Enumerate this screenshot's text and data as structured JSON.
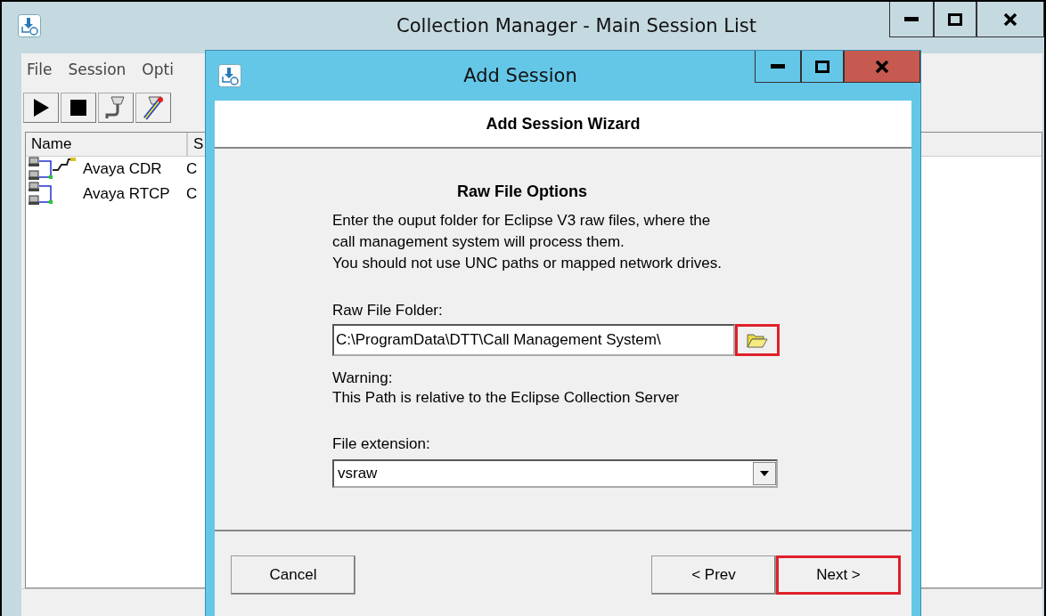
{
  "main_window": {
    "title": "Collection Manager - Main Session List",
    "menu": [
      "File",
      "Session",
      "Opti"
    ],
    "toolbar": [
      {
        "kind": "play"
      },
      {
        "kind": "stop"
      },
      {
        "kind": "connector"
      },
      {
        "kind": "connector-edit"
      }
    ],
    "list": {
      "columns": [
        "Name",
        "S"
      ],
      "rows": [
        {
          "name": "Avaya CDR",
          "column_2": "C",
          "kind": "cdr"
        },
        {
          "name": "Avaya RTCP",
          "column_2": "C",
          "kind": "plain"
        }
      ]
    }
  },
  "dialog": {
    "title": "Add Session",
    "header": "Add Session Wizard",
    "section_title": "Raw File Options",
    "description": [
      "Enter the ouput folder for Eclipse V3 raw files, where the",
      "call management system will process them.",
      "You should not use UNC paths or mapped  network drives."
    ],
    "folder_label": "Raw File Folder:",
    "folder_value": "C:\\ProgramData\\DTT\\Call Management System\\",
    "browse_button": {
      "highlighted": true
    },
    "warning_label": "Warning:",
    "warning_text": "This Path is relative to the Eclipse Collection Server",
    "extension_label": "File extension:",
    "extension_value": "vsraw",
    "buttons": [
      {
        "label": "Cancel",
        "highlighted": false
      },
      {
        "label": "< Prev",
        "highlighted": false
      },
      {
        "label": "Next >",
        "highlighted": true
      }
    ]
  }
}
